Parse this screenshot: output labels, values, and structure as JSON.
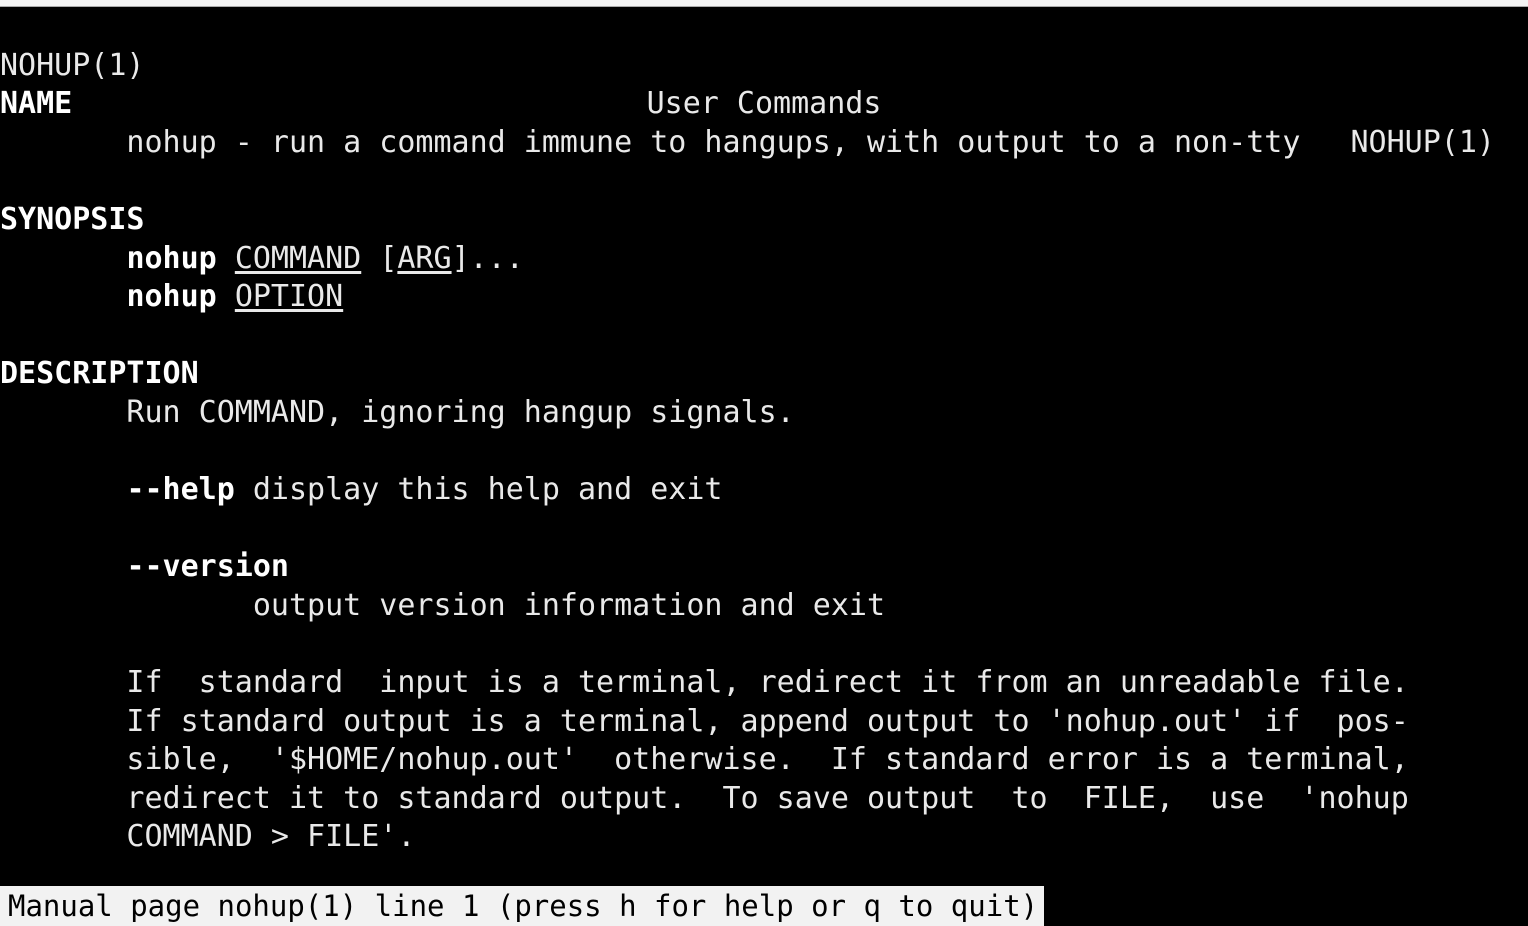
{
  "window": {
    "app": "terminal",
    "background_color": "#000000",
    "foreground_color": "#e9e9e9",
    "statusbar_background": "#f2f2f2",
    "statusbar_foreground": "#000000"
  },
  "manpage": {
    "header": {
      "left": "NOHUP(1)",
      "center": "User Commands",
      "right": "NOHUP(1)"
    },
    "sections": {
      "name": {
        "heading": "NAME",
        "body": "       nohup - run a command immune to hangups, with output to a non-tty"
      },
      "synopsis": {
        "heading": "SYNOPSIS",
        "indent": "       ",
        "line1": {
          "command": "nohup",
          "space1": " ",
          "arg_command": "COMMAND",
          "space2": " ",
          "bracket_open": "[",
          "arg_arg": "ARG",
          "bracket_close": "]...",
          "plain": "nohup COMMAND [ARG]..."
        },
        "line2": {
          "command": "nohup",
          "space1": " ",
          "arg_option": "OPTION",
          "plain": "nohup OPTION"
        }
      },
      "description": {
        "heading": "DESCRIPTION",
        "intro": "       Run COMMAND, ignoring hangup signals.",
        "options": [
          {
            "indent": "       ",
            "flag": "--help",
            "text": " display this help and exit"
          },
          {
            "indent": "       ",
            "flag": "--version",
            "text": "",
            "continuation": "              output version information and exit"
          }
        ],
        "paragraph": [
          "       If  standard  input is a terminal, redirect it from an unreadable file.",
          "       If standard output is a terminal, append output to 'nohup.out' if  pos-",
          "       sible,  '$HOME/nohup.out'  otherwise.  If standard error is a terminal,",
          "       redirect it to standard output.  To save output  to  FILE,  use  'nohup",
          "       COMMAND > FILE'."
        ]
      }
    }
  },
  "statusbar": {
    "text": "Manual page nohup(1) line 1 (press h for help or q to quit)"
  }
}
